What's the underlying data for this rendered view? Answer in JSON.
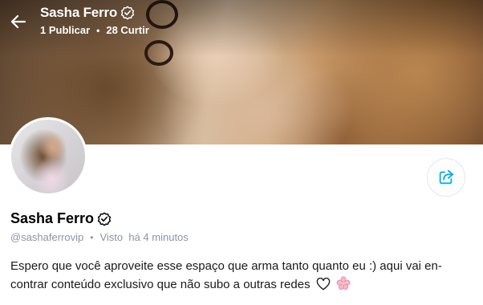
{
  "header": {
    "name": "Sasha Ferro",
    "posts": "1 Publicar",
    "likes": "28 Curtir",
    "separator": "•"
  },
  "profile": {
    "name": "Sasha Ferro",
    "handle": "@sashaferrovip",
    "separator": "•",
    "seen_label": "Visto",
    "seen_time": "há 4 minutos",
    "bio_line1": "Espero que você aproveite esse espaço que arma tanto quanto eu :) aqui vai en-",
    "bio_line2": "contrar conteúdo exclusivo que não subo a outras redes"
  },
  "icons": {
    "back": "arrow-left-icon",
    "verified": "verified-badge-icon",
    "share": "share-icon",
    "heart": "heart-outline-icon",
    "flower": "cherry-blossom-icon"
  },
  "colors": {
    "accent": "#00aff0",
    "meta_text": "#8a96a3"
  }
}
